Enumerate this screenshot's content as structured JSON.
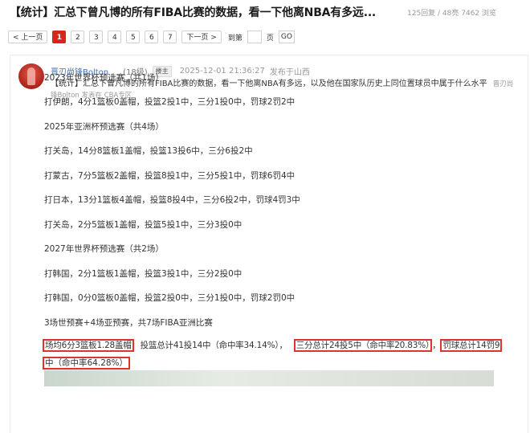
{
  "header": {
    "title": "【统计】汇总下曾凡博的所有FIBA比赛的数据，看一下他离NBA有多远...",
    "stats": "125回复 / 48亮 7462 浏览"
  },
  "pager": {
    "prev": "< 上一页",
    "pages": [
      "1",
      "2",
      "3",
      "4",
      "5",
      "6",
      "7"
    ],
    "current": "1",
    "next": "下一页 >",
    "goto_label": "到第",
    "page_label": "页",
    "go": "GO"
  },
  "post": {
    "author": "晋刃尚锋Bolton",
    "level": "(18级)",
    "badge": "楼主",
    "time": "2025-12-01 21:36:27",
    "location": "发布于山西",
    "summary": "【统计】汇总下曾凡博的所有FIBA比赛的数据，看一下他离NBA有多远，以及他在国家队历史上同位置球员中属于什么水平",
    "summary_sub": "晋刃尚锋Bolton 发表在 CBA专区",
    "lines": [
      "2023年世界杯预选赛（共1场）",
      "打伊朗，4分1篮板0盖帽，投篮2投1中，三分1投0中，罚球2罚2中",
      "2025年亚洲杯预选赛（共4场）",
      "打关岛，14分8篮板1盖帽，投篮13投6中，三分6投2中",
      "打蒙古，7分5篮板2盖帽，投篮8投1中，三分5投1中，罚球6罚4中",
      "打日本，13分1篮板4盖帽，投篮8投4中，三分6投2中，罚球4罚3中",
      "打关岛，2分5篮板1盖帽，投篮5投1中，三分3投0中",
      "2027年世界杯预选赛（共2场）",
      "打韩国，2分1篮板1盖帽，投篮3投1中，三分2投0中",
      "打韩国，0分0篮板0盖帽，投篮2投0中，三分1投0中，罚球2罚0中",
      "3场世预赛+4场亚预赛，共7场FIBA亚洲比赛"
    ],
    "highlight": {
      "avg": "场均6分3篮板1.28盖帽",
      "fg": "投篮总计41投14中（命中率34.14%），",
      "three": "三分总计24投5中（命中率20.83%）",
      "sep": "，",
      "ft1": "罚球总计14罚9",
      "ft2": "中（命中率64.28%）"
    }
  },
  "colors": {
    "accent": "#d9261c",
    "link": "#3d6fb6",
    "highlight_border": "#e0332b"
  }
}
